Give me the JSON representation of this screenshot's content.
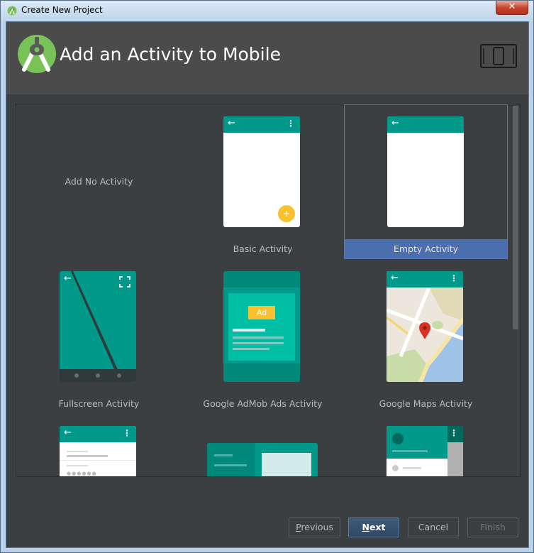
{
  "window": {
    "title": "Create New Project",
    "close_label": "✕"
  },
  "header": {
    "title": "Add an Activity to Mobile"
  },
  "activities": [
    {
      "label": "Add No Activity"
    },
    {
      "label": "Basic Activity"
    },
    {
      "label": "Empty Activity",
      "selected": true
    },
    {
      "label": "Fullscreen Activity"
    },
    {
      "label": "Google AdMob Ads Activity",
      "ad_text": "Ad"
    },
    {
      "label": "Google Maps Activity"
    }
  ],
  "footer": {
    "previous_first": "P",
    "previous_rest": "revious",
    "next_first": "N",
    "next_rest": "ext",
    "cancel": "Cancel",
    "finish": "Finish"
  },
  "colors": {
    "teal": "#00998a",
    "selection": "#4b6eaf",
    "header_bg": "#4b4b4b",
    "body_bg": "#3c3f41",
    "fab": "#fbc02d"
  }
}
